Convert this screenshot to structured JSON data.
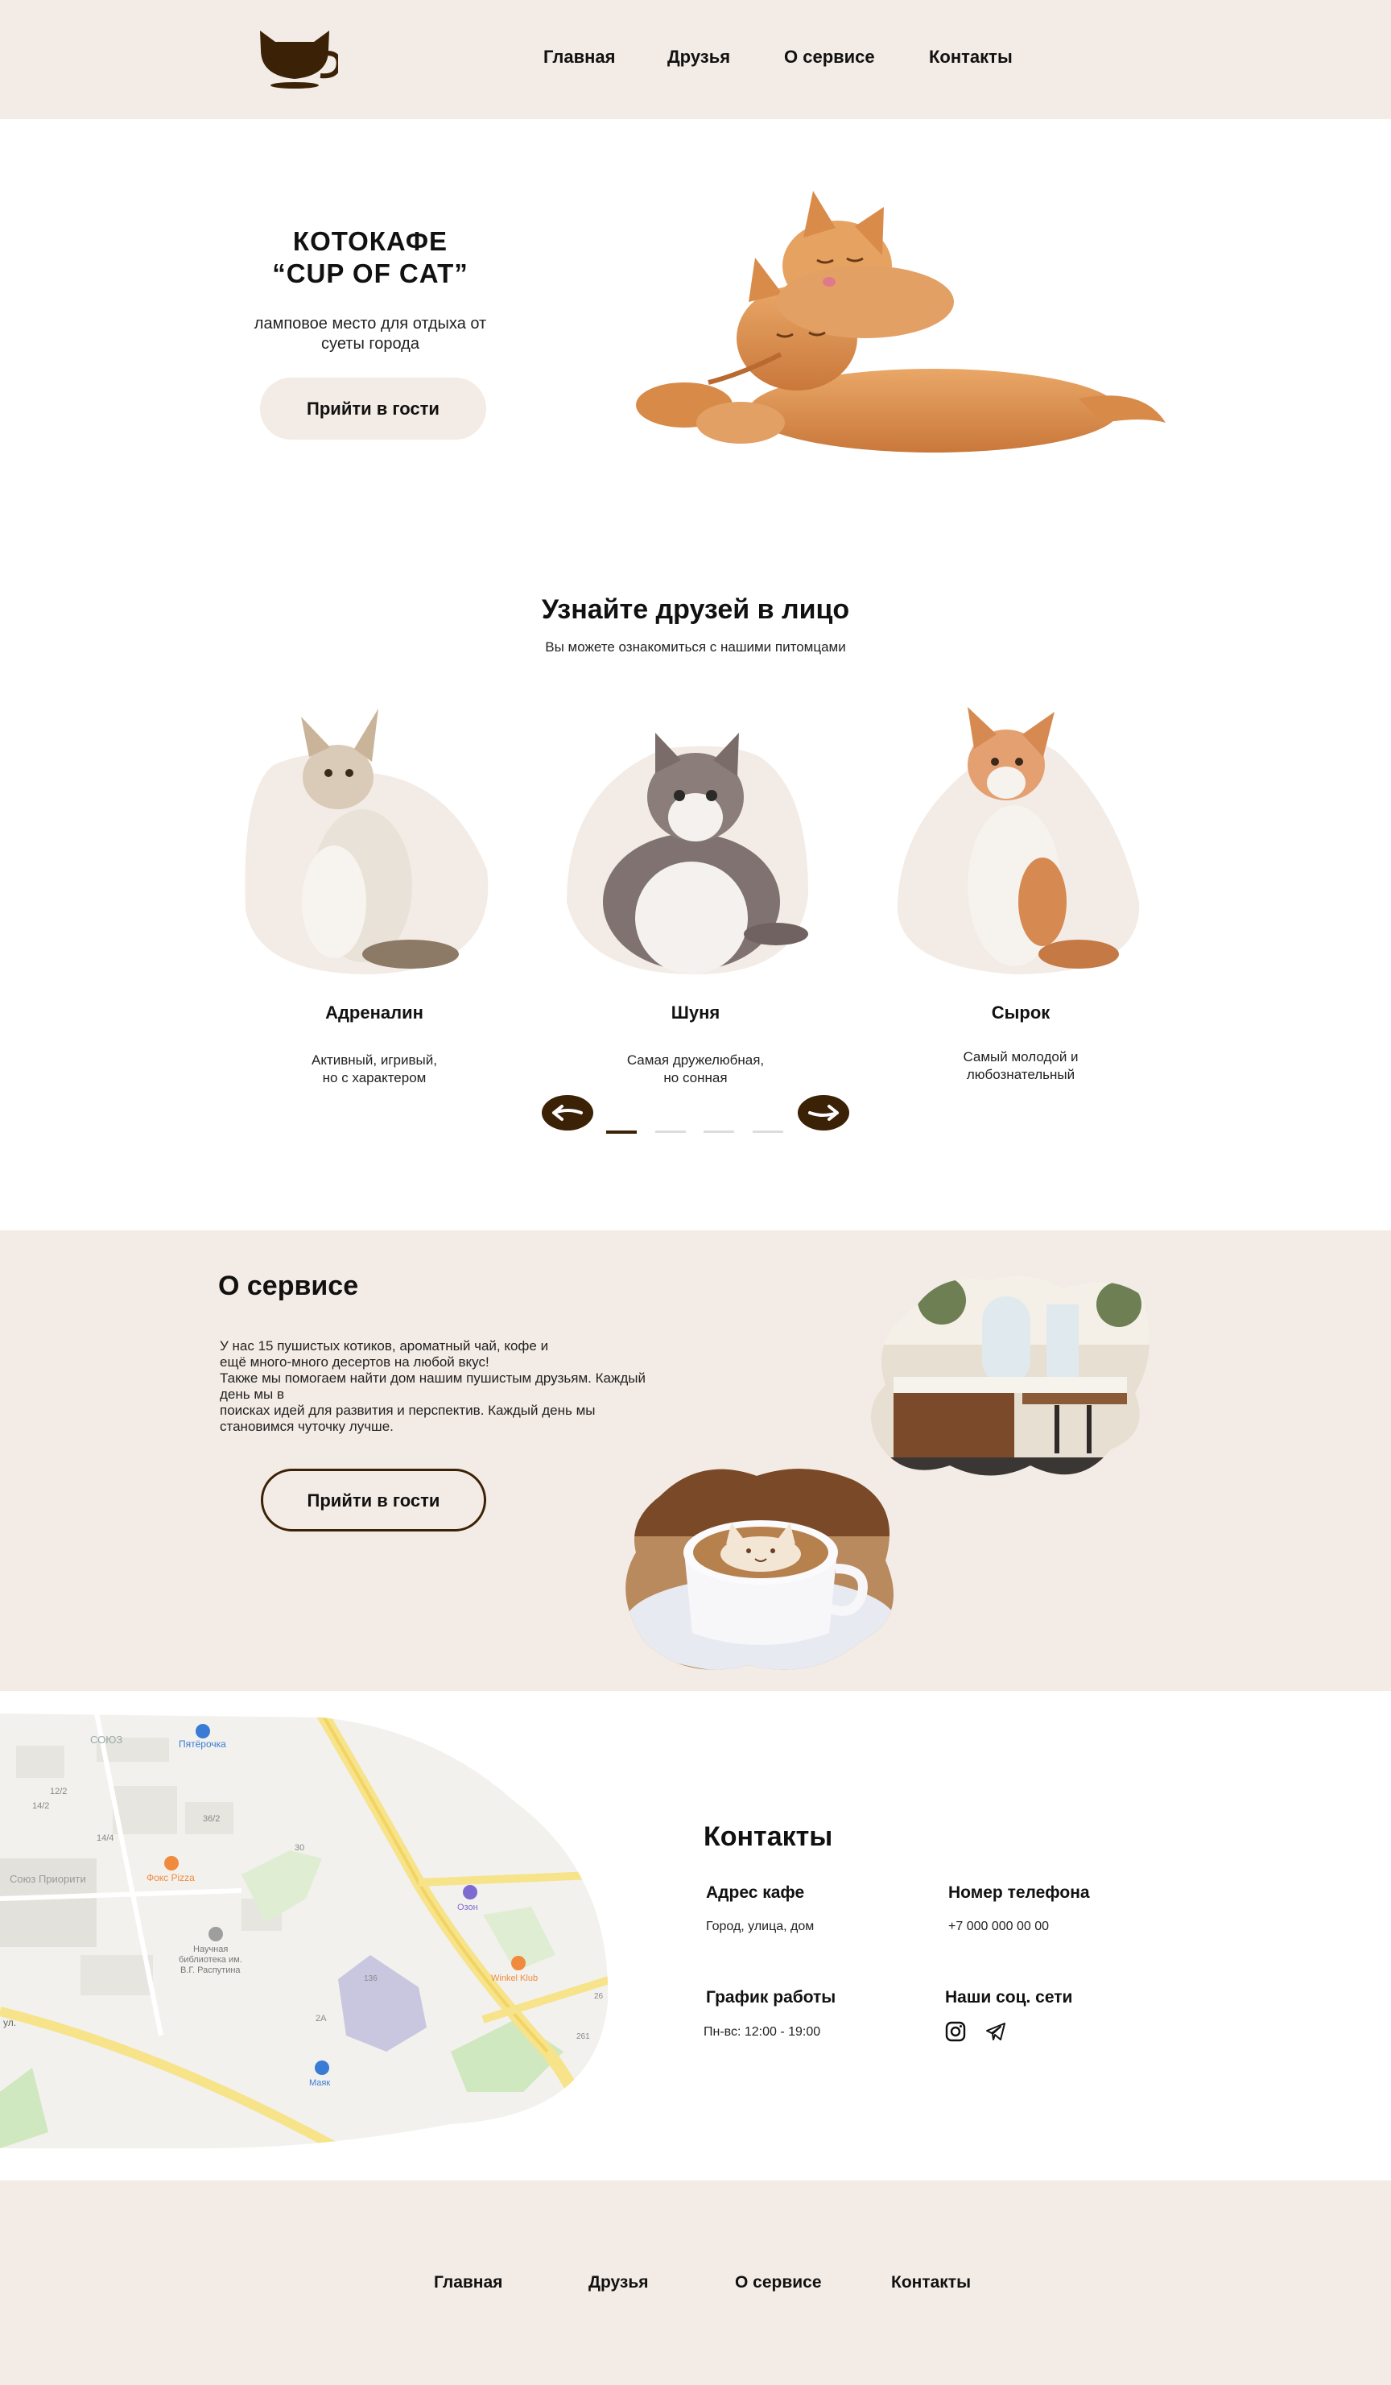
{
  "nav": {
    "items": [
      "Главная",
      "Друзья",
      "О сервисе",
      "Контакты"
    ]
  },
  "hero": {
    "title_line1": "КОТОКАФЕ",
    "title_line2": "“CUP OF CAT”",
    "subtitle": "ламповое место для отдыха от суеты города",
    "button": "Прийти в гости"
  },
  "friends": {
    "title": "Узнайте друзей в лицо",
    "subtitle": "Вы можете ознакомиться с нашими питомцами",
    "pets": [
      {
        "name": "Адреналин",
        "desc_line1": "Активный, игривый,",
        "desc_line2": "но с характером"
      },
      {
        "name": "Шуня",
        "desc_line1": "Самая дружелюбная,",
        "desc_line2": "но сонная"
      },
      {
        "name": "Сырок",
        "desc_line1": "Самый молодой и",
        "desc_line2": "любознательный"
      }
    ],
    "slider": {
      "total_dots": 4,
      "active_dot": 1
    }
  },
  "about": {
    "title": "О сервисе",
    "lines": [
      "У нас 15 пушистых котиков, ароматный чай, кофе и",
      "ещё много-много десертов на любой вкус!",
      "Также мы помогаем найти дом нашим пушистым друзьям. Каждый",
      "день мы в",
      "поисках идей для развития и перспектив. Каждый день мы",
      "становимся чуточку лучше."
    ],
    "button": "Прийти в гости"
  },
  "map": {
    "labels": {
      "soyuz": "СОЮЗ",
      "pyaterochka": "Пятёрочка",
      "soyuz_priority": "Союз Приорити",
      "fox_pizza": "Фокс Pizza",
      "library_1": "Научная",
      "library_2": "библиотека им.",
      "library_3": "В.Г. Распутина",
      "ozon": "Озон",
      "winkel": "Winkel Klub",
      "mayak": "Маяк",
      "street": "ул.",
      "n14_2": "14/2",
      "n12_2": "12/2",
      "n14_4": "14/4",
      "n36_2": "36/2",
      "n30": "30",
      "n2a": "2А",
      "n136": "136",
      "n26": "26",
      "n261": "261"
    }
  },
  "contacts": {
    "title": "Контакты",
    "address_label": "Адрес кафе",
    "address_value": "Город, улица, дом",
    "phone_label": "Номер телефона",
    "phone_value": "+7 000 000 00 00",
    "hours_label": "График работы",
    "hours_value": "Пн-вс: 12:00 - 19:00",
    "social_label": "Наши соц. сети",
    "social_icons": [
      "instagram-icon",
      "telegram-icon"
    ]
  },
  "footer": {
    "items": [
      "Главная",
      "Друзья",
      "О сервисе",
      "Контакты"
    ]
  },
  "colors": {
    "beige": "#f3ebe5",
    "brown": "#3b2206",
    "text": "#111111"
  }
}
